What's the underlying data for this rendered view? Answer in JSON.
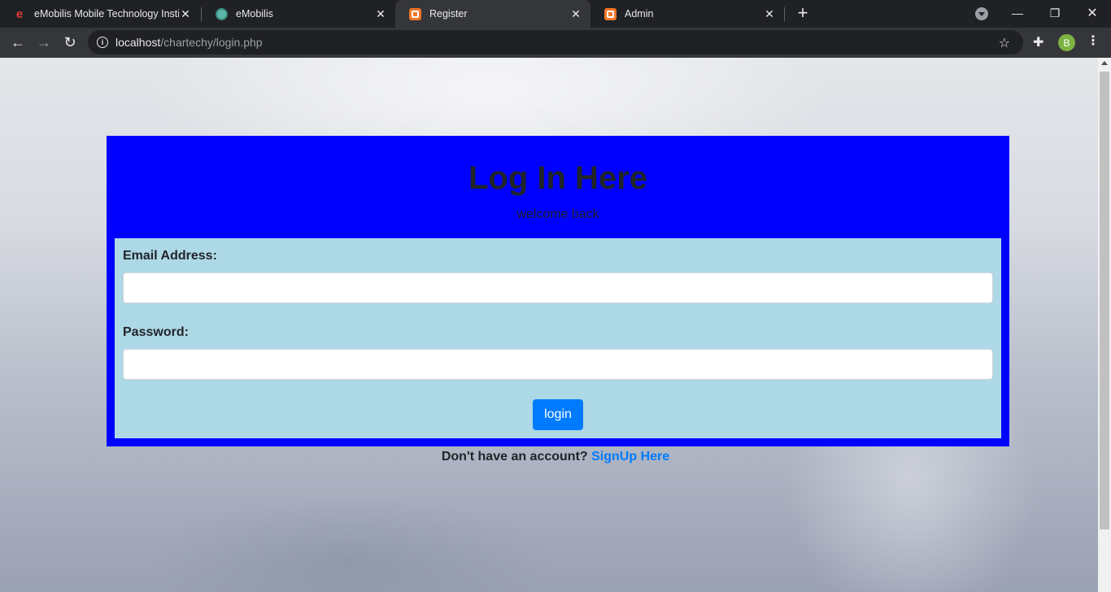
{
  "browser": {
    "tabs": [
      {
        "title": "eMobilis Mobile Technology Insti",
        "favicon": "emobilis-e-icon"
      },
      {
        "title": "eMobilis",
        "favicon": "globe-icon"
      },
      {
        "title": "Register",
        "favicon": "xampp-icon",
        "active": true
      },
      {
        "title": "Admin",
        "favicon": "xampp-icon"
      }
    ],
    "url_host": "localhost",
    "url_path": "/chartechy/login.php",
    "profile_initial": "B"
  },
  "page": {
    "heading": "Log In Here",
    "subheading": "welcome back",
    "email_label": "Email Address:",
    "email_value": "",
    "password_label": "Password:",
    "password_value": "",
    "login_button": "login",
    "signup_prompt": "Don't have an account?",
    "signup_link": "SignUp Here"
  },
  "colors": {
    "card_bg": "#0000ff",
    "form_bg": "#add8e6",
    "button_bg": "#007bff",
    "link": "#007bff"
  }
}
